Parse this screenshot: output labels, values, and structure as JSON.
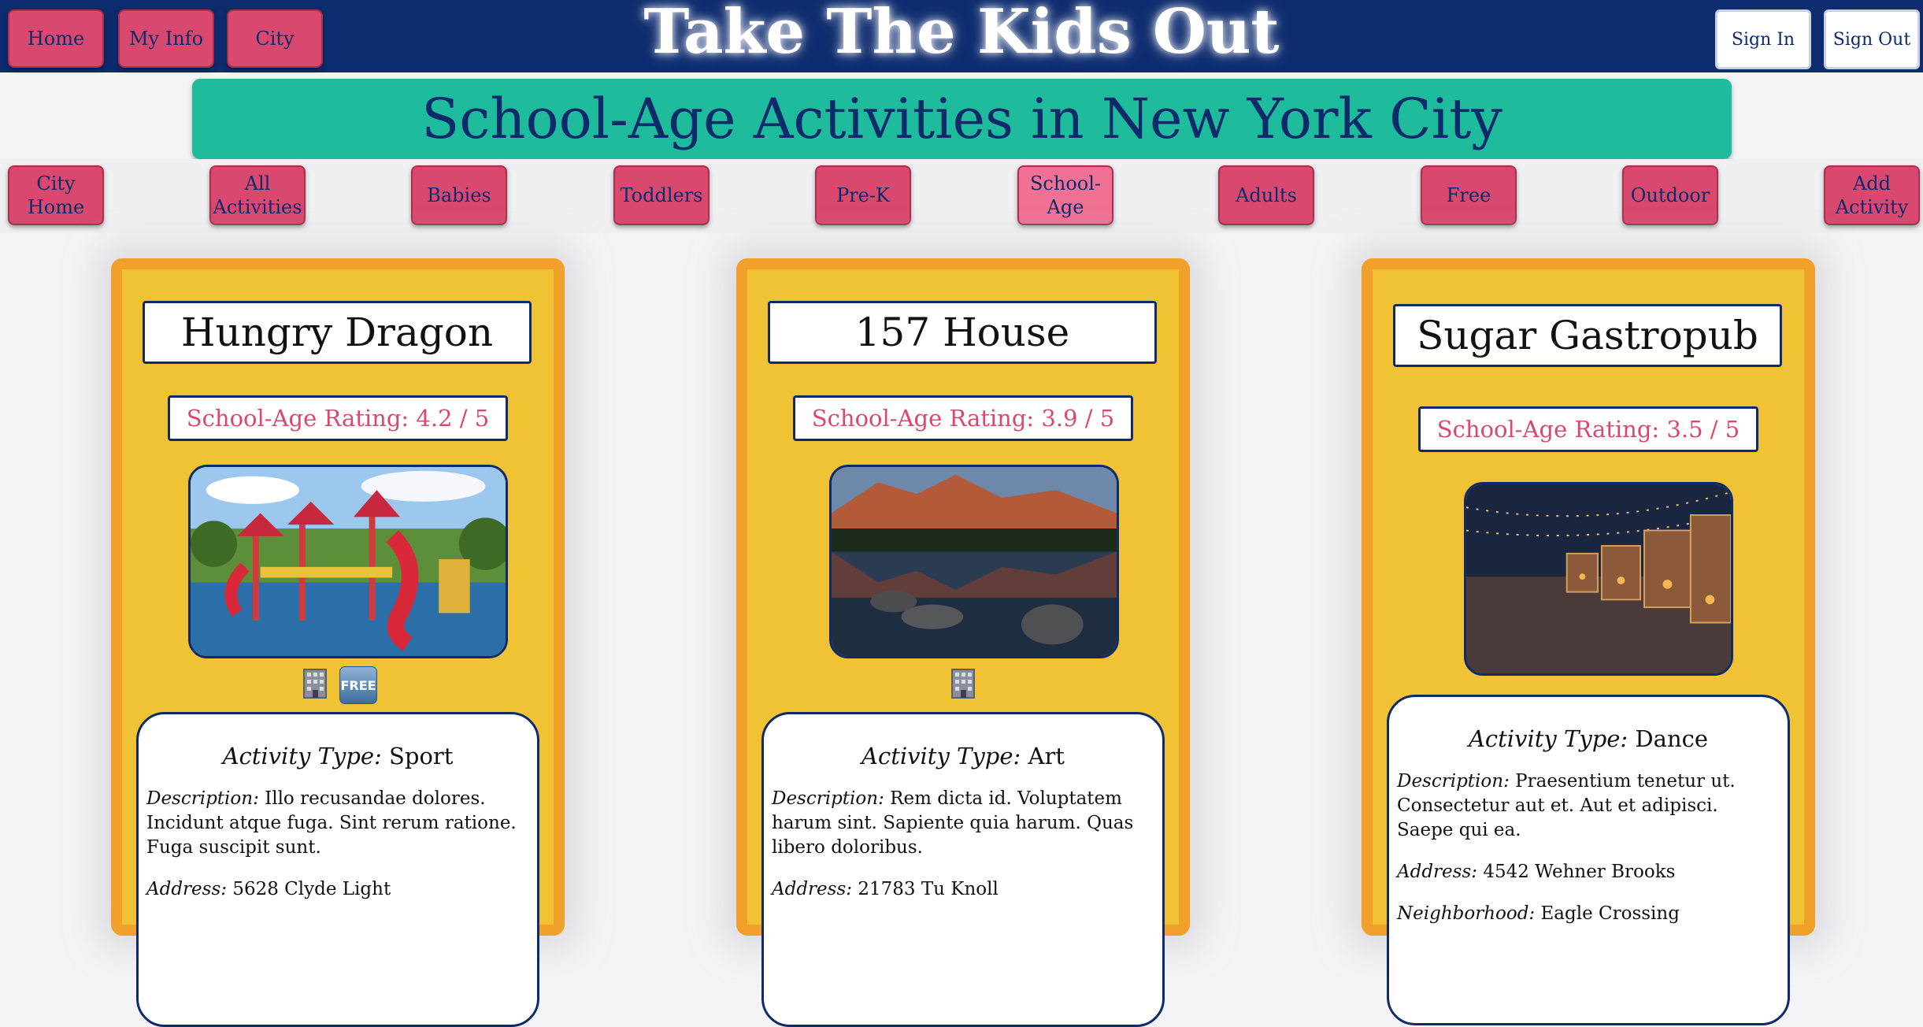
{
  "topbar": {
    "site_title": "Take The Kids Out",
    "nav": [
      {
        "label": "Home"
      },
      {
        "label": "My Info"
      },
      {
        "label": "City"
      }
    ],
    "sign_in": "Sign In",
    "sign_out": "Sign Out"
  },
  "banner": {
    "title": "School-Age Activities in New York City"
  },
  "subnav": [
    {
      "label": "City Home"
    },
    {
      "label": "All Activities"
    },
    {
      "label": "Babies"
    },
    {
      "label": "Toddlers"
    },
    {
      "label": "Pre-K"
    },
    {
      "label": "School-Age",
      "active": true
    },
    {
      "label": "Adults"
    },
    {
      "label": "Free"
    },
    {
      "label": "Outdoor"
    },
    {
      "label": "Add Activity"
    }
  ],
  "cards": [
    {
      "name": "Hungry Dragon",
      "rating": "School-Age Rating: 4.2 / 5",
      "image": "playground",
      "icons": [
        "building-icon",
        "free-icon"
      ],
      "free_badge": "FREE",
      "type_label": "Activity Type:",
      "type": " Sport",
      "description_label": "Description:",
      "description": " Illo recusandae dolores. Incidunt atque fuga. Sint rerum ratione. Fuga suscipit sunt.",
      "address_label": "Address:",
      "address": " 5628 Clyde Light"
    },
    {
      "name": "157 House",
      "rating": "School-Age Rating: 3.9 / 5",
      "image": "mountain-lake",
      "icons": [
        "building-icon"
      ],
      "type_label": "Activity Type:",
      "type": " Art",
      "description_label": "Description:",
      "description": " Rem dicta id. Voluptatem harum sint. Sapiente quia harum. Quas libero doloribus.",
      "address_label": "Address:",
      "address": " 21783 Tu Knoll"
    },
    {
      "name": "Sugar Gastropub",
      "rating": "School-Age Rating: 3.5 / 5",
      "image": "night-market",
      "icons": [],
      "type_label": "Activity Type:",
      "type": " Dance",
      "description_label": "Description:",
      "description": " Praesentium tenetur ut. Consectetur aut et. Aut et adipisci. Saepe qui ea.",
      "address_label": "Address:",
      "address": " 4542 Wehner Brooks",
      "neighborhood_label": "Neighborhood:",
      "neighborhood": " Eagle Crossing"
    }
  ],
  "colors": {
    "topbar": "#0d2b6e",
    "button": "#d9496f",
    "button_active": "#f07194",
    "banner": "#1fbb9d",
    "card": "#f1c233",
    "card_border": "#f1a02a"
  }
}
